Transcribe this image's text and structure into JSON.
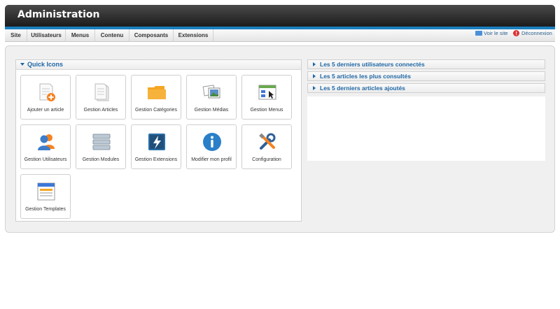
{
  "header": {
    "title": "Administration"
  },
  "menu": {
    "items": [
      {
        "label": "Site"
      },
      {
        "label": "Utilisateurs"
      },
      {
        "label": "Menus"
      },
      {
        "label": "Contenu"
      },
      {
        "label": "Composants"
      },
      {
        "label": "Extensions"
      }
    ],
    "view_site": "Voir le site",
    "logout": "Déconnexion"
  },
  "quick_icons": {
    "title": "Quick Icons",
    "items": [
      {
        "label": "Ajouter un article",
        "icon": "add-article-icon"
      },
      {
        "label": "Gestion Articles",
        "icon": "articles-icon"
      },
      {
        "label": "Gestion Catégories",
        "icon": "folder-icon"
      },
      {
        "label": "Gestion Médias",
        "icon": "media-icon"
      },
      {
        "label": "Gestion Menus",
        "icon": "menus-icon"
      },
      {
        "label": "Gestion Utilisateurs",
        "icon": "users-icon"
      },
      {
        "label": "Gestion Modules",
        "icon": "modules-icon"
      },
      {
        "label": "Gestion Extensions",
        "icon": "extensions-icon"
      },
      {
        "label": "Modifier mon profil",
        "icon": "info-icon"
      },
      {
        "label": "Configuration",
        "icon": "config-icon"
      },
      {
        "label": "Gestion Templates",
        "icon": "templates-icon"
      }
    ]
  },
  "panels": [
    {
      "label": "Les 5 derniers utilisateurs connectés"
    },
    {
      "label": "Les 5 articles les plus consultés"
    },
    {
      "label": "Les 5 derniers articles ajoutés"
    }
  ],
  "colors": {
    "accent": "#1f67a5",
    "header_dark": "#1c1c1c",
    "blue_line": "#1a7fbf"
  }
}
